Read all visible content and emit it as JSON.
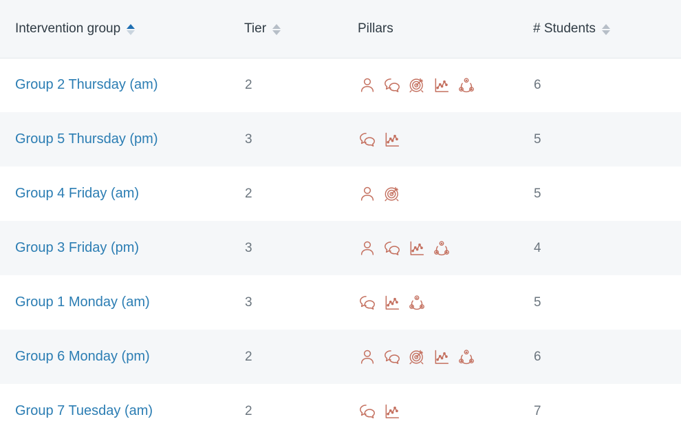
{
  "table": {
    "columns": [
      {
        "key": "group",
        "label": "Intervention group",
        "sortable": true,
        "sort_state": "asc",
        "sort_icon": "sort-arrows-icon"
      },
      {
        "key": "tier",
        "label": "Tier",
        "sortable": true,
        "sort_state": "none",
        "sort_icon": "sort-arrows-icon"
      },
      {
        "key": "pillars",
        "label": "Pillars",
        "sortable": false,
        "sort_state": "none",
        "sort_icon": null
      },
      {
        "key": "students",
        "label": "# Students",
        "sortable": true,
        "sort_state": "none",
        "sort_icon": "sort-arrows-icon"
      }
    ],
    "pillar_icon_names": {
      "person": "person-icon",
      "speech": "speech-bubbles-icon",
      "target": "target-icon",
      "chart": "line-chart-icon",
      "network": "network-nodes-icon"
    },
    "rows": [
      {
        "group": "Group 2 Thursday (am)",
        "tier": "2",
        "pillars": [
          "person",
          "speech",
          "target",
          "chart",
          "network"
        ],
        "students": "6"
      },
      {
        "group": "Group 5 Thursday (pm)",
        "tier": "3",
        "pillars": [
          "speech",
          "chart"
        ],
        "students": "5"
      },
      {
        "group": "Group 4 Friday (am)",
        "tier": "2",
        "pillars": [
          "person",
          "target"
        ],
        "students": "5"
      },
      {
        "group": "Group 3 Friday (pm)",
        "tier": "3",
        "pillars": [
          "person",
          "speech",
          "chart",
          "network"
        ],
        "students": "4"
      },
      {
        "group": "Group 1 Monday (am)",
        "tier": "3",
        "pillars": [
          "speech",
          "chart",
          "network"
        ],
        "students": "5"
      },
      {
        "group": "Group 6 Monday (pm)",
        "tier": "2",
        "pillars": [
          "person",
          "speech",
          "target",
          "chart",
          "network"
        ],
        "students": "6"
      },
      {
        "group": "Group 7 Tuesday (am)",
        "tier": "2",
        "pillars": [
          "speech",
          "chart"
        ],
        "students": "7"
      }
    ]
  },
  "colors": {
    "link": "#2b7db3",
    "pillar_icon": "#c4705f",
    "header_bg": "#f5f7f9",
    "row_alt_bg": "#f5f7f9",
    "text": "#6c757d",
    "sort_active": "#1f6fb2",
    "sort_inactive": "#b6bec7"
  }
}
